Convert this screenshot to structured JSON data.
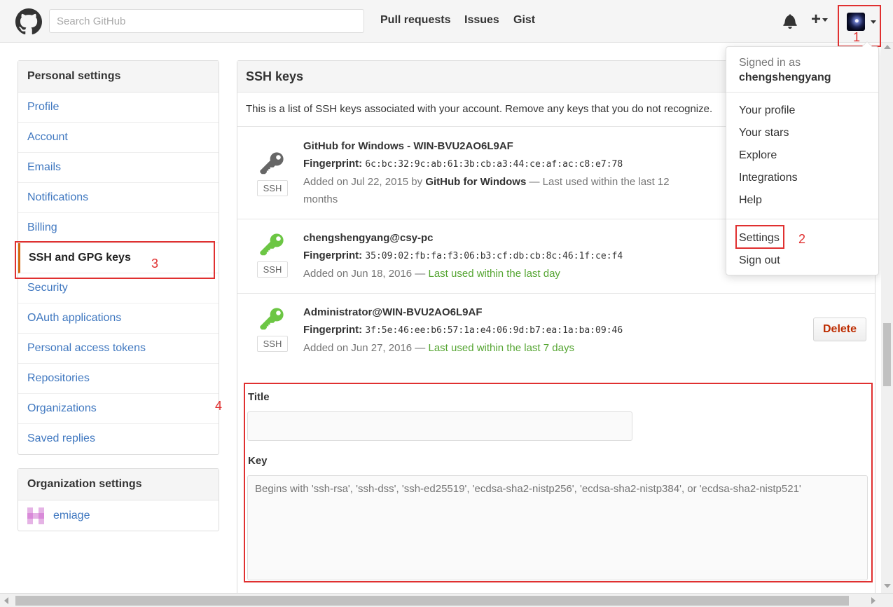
{
  "header": {
    "search_placeholder": "Search GitHub",
    "nav": [
      "Pull requests",
      "Issues",
      "Gist"
    ],
    "icons": [
      "github-logo",
      "bell-icon",
      "plus-icon",
      "avatar"
    ]
  },
  "annotations": {
    "one": "1",
    "two": "2",
    "three": "3",
    "four": "4",
    "color": "#e03030"
  },
  "sidebar": {
    "personal_heading": "Personal settings",
    "items": [
      {
        "label": "Profile"
      },
      {
        "label": "Account"
      },
      {
        "label": "Emails"
      },
      {
        "label": "Notifications"
      },
      {
        "label": "Billing"
      },
      {
        "label": "SSH and GPG keys"
      },
      {
        "label": "Security"
      },
      {
        "label": "OAuth applications"
      },
      {
        "label": "Personal access tokens"
      },
      {
        "label": "Repositories"
      },
      {
        "label": "Organizations"
      },
      {
        "label": "Saved replies"
      }
    ],
    "org_heading": "Organization settings",
    "org_name": "emiage"
  },
  "main": {
    "heading": "SSH keys",
    "intro": "This is a list of SSH keys associated with your account. Remove any keys that you do not recognize.",
    "ssh_badge": "SSH",
    "fingerprint_label": "Fingerprint:",
    "keys": [
      {
        "title": "GitHub for Windows - WIN-BVU2AO6L9AF",
        "fingerprint": "6c:bc:32:9c:ab:61:3b:cb:a3:44:ce:af:ac:c8:e7:78",
        "added_prefix": "Added on Jul 22, 2015 by ",
        "added_by": "GitHub for Windows",
        "last_used": " — Last used within the last 12 months",
        "icon_color": "#666666"
      },
      {
        "title": "chengshengyang@csy-pc",
        "fingerprint": "35:09:02:fb:fa:f3:06:b3:cf:db:cb:8c:46:1f:ce:f4",
        "added_prefix": "Added on Jun 18, 2016 — ",
        "last_used": "Last used within the last day",
        "icon_color": "#6cc644"
      },
      {
        "title": "Administrator@WIN-BVU2AO6L9AF",
        "fingerprint": "3f:5e:46:ee:b6:57:1a:e4:06:9d:b7:ea:1a:ba:09:46",
        "added_prefix": "Added on Jun 27, 2016 — ",
        "last_used": "Last used within the last 7 days",
        "icon_color": "#6cc644",
        "delete_label": "Delete"
      }
    ],
    "form": {
      "title_label": "Title",
      "title_value": "",
      "key_label": "Key",
      "key_placeholder": "Begins with 'ssh-rsa', 'ssh-dss', 'ssh-ed25519', 'ecdsa-sha2-nistp256', 'ecdsa-sha2-nistp384', or 'ecdsa-sha2-nistp521'"
    }
  },
  "dropdown": {
    "signed_in_as": "Signed in as",
    "username": "chengshengyang",
    "items": [
      "Your profile",
      "Your stars",
      "Explore",
      "Integrations",
      "Help"
    ],
    "settings": "Settings",
    "sign_out": "Sign out"
  }
}
